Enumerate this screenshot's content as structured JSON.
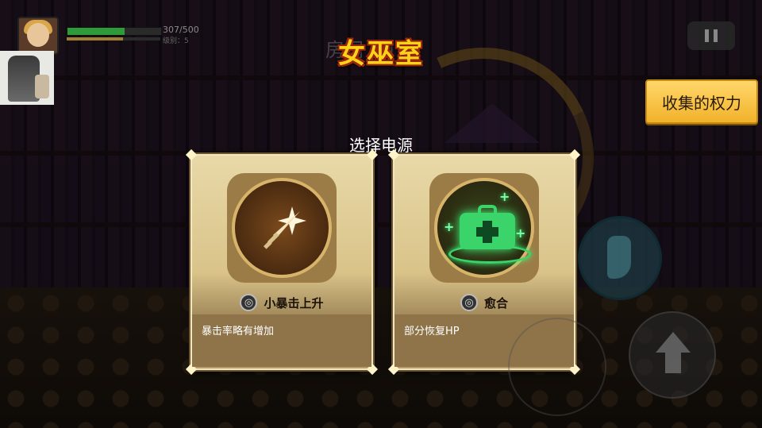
{
  "hud": {
    "hp_text": "307/500",
    "hp_fraction": 0.614,
    "level_text": "级别：5",
    "exp_fraction": 0.6
  },
  "room": {
    "title": "女巫室",
    "ghost_title": "房间 10"
  },
  "collect_button": {
    "label": "收集的权力"
  },
  "selection": {
    "prompt": "选择电源"
  },
  "cards": [
    {
      "name": "小暴击上升",
      "description": "暴击率略有增加",
      "icon": "sword-star-icon",
      "name_icon": "swirl-icon"
    },
    {
      "name": "愈合",
      "description": "部分恢复HP",
      "icon": "medkit-icon",
      "name_icon": "swirl-icon"
    }
  ],
  "controls": {
    "pause_icon": "pause-icon",
    "dash_icon": "boot-icon",
    "jump_icon": "up-arrow-icon"
  },
  "colors": {
    "title": "#ffd21a",
    "collect_button": "#f2b22a",
    "hp": "#2f9a3a",
    "heal_glow": "#3ad46a"
  }
}
